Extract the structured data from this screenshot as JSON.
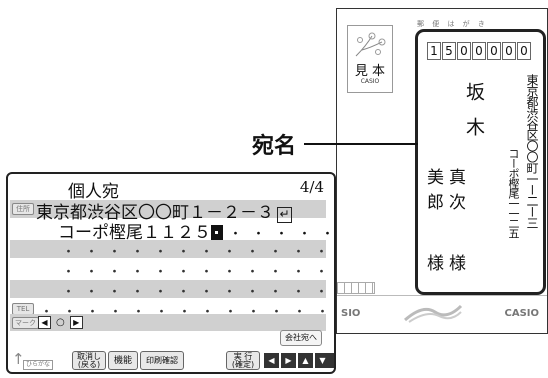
{
  "postcard": {
    "header": "郵 便 は が き",
    "stamp_label": "見 本",
    "stamp_brand": "CASIO",
    "zip": [
      "1",
      "5",
      "0",
      "0",
      "0",
      "0",
      "0"
    ],
    "address_line1": "東京都渋谷区〇〇町一ー二ー三",
    "address_line2": "コーポ樫尾一一二五",
    "family_name": "坂木",
    "given_name_1": "真次",
    "given_name_2": "美郎",
    "honorific_1": "様",
    "honorific_2": "様",
    "logo_left": "SIO",
    "logo_right": "CASIO"
  },
  "callout": {
    "label": "宛名"
  },
  "screen": {
    "title": "個人宛",
    "page": "4/4",
    "address_tag": "住所",
    "address_line1": "東京都渋谷区〇〇町１－２－３",
    "return_mark": "↵",
    "address_line2": "コーポ樫尾１１２５",
    "dots": "・・・・・・",
    "dots_full": "・・・・・・・・・・・・・",
    "tel_tag": "TEL",
    "mark_tag": "マーク",
    "mark_left": "◀",
    "mark_sep": "○",
    "mark_right": "▶",
    "company_button": "会社宛へ"
  },
  "toolbar": {
    "input_mode": "ひらがな",
    "cancel": "取消し\n(戻る)",
    "function": "機能",
    "print_check": "印刷確認",
    "execute": "実 行\n(確定)",
    "nav_left": "◀",
    "nav_right": "▶",
    "nav_up": "▲",
    "nav_down": "▼"
  }
}
